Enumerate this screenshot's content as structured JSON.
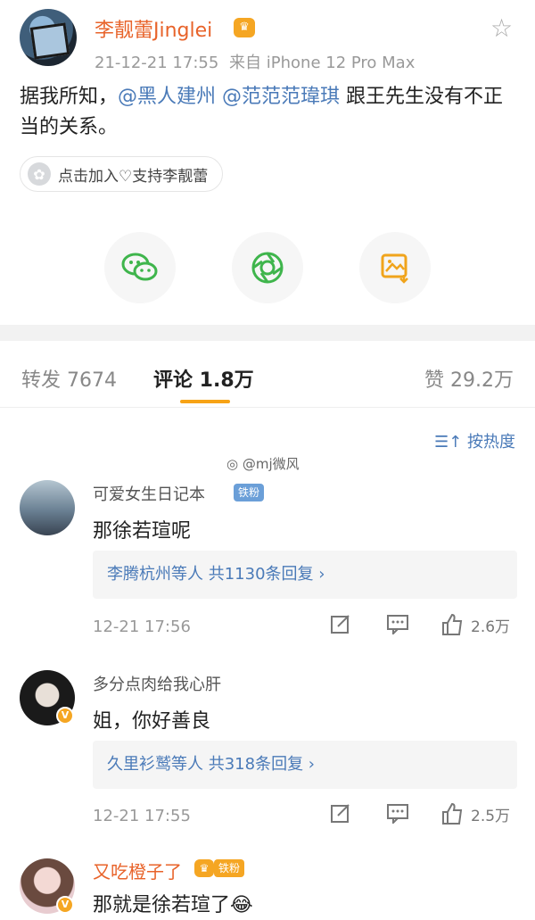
{
  "post": {
    "user_name": "李靓蕾Jinglei",
    "vip_badge": "♛",
    "date": "21-12-21 17:55",
    "source": "来自 iPhone 12 Pro Max",
    "text_before": "据我所知，",
    "mention_1": "@黑人建州",
    "mention_2": "@范范范瑋琪",
    "text_after": " 跟王先生没有不正当的关系。",
    "support_label": "点击加入♡支持李靓蕾",
    "star_icon": "☆"
  },
  "share": {
    "icons": [
      "wechat-icon",
      "moments-icon",
      "save-image-icon"
    ],
    "wechat_color": "#3fb54c",
    "moments_color": "#3fb54c",
    "save_color": "#f0a41c"
  },
  "tabs": {
    "repost": "转发 7674",
    "comment": "评论 1.8万",
    "like": "赞 29.2万"
  },
  "sort_label": "按热度",
  "watermark": "@mj微风",
  "comments": [
    {
      "name": "可爱女生日记本",
      "badge": "铁粉",
      "text": "那徐若瑄呢",
      "replies": "李腾杭州等人  共1130条回复 ›",
      "time": "12-21 17:56",
      "likes": "2.6万"
    },
    {
      "name": "多分点肉给我心肝",
      "verified": "V",
      "text": "姐，你好善良",
      "replies": "久里衫鹫等人  共318条回复 ›",
      "time": "12-21 17:55",
      "likes": "2.5万"
    },
    {
      "name": "又吃橙子了",
      "badge": "铁粉",
      "verified": "V",
      "text": "那就是徐若瑄了😂"
    }
  ]
}
